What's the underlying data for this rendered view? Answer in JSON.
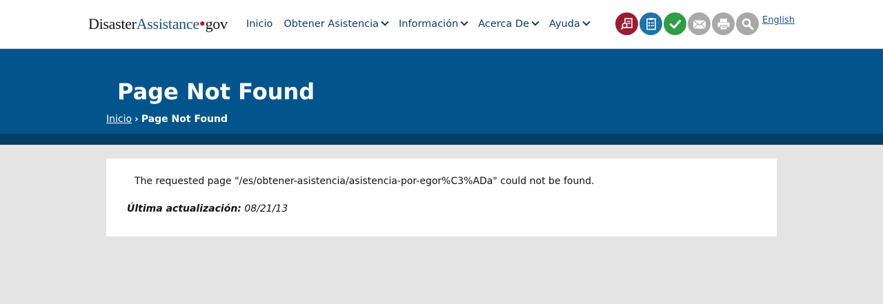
{
  "header": {
    "logo": {
      "part1": "Disaster",
      "part2": "Assistance",
      "dot": "•",
      "part3": "gov"
    },
    "nav": [
      {
        "label": "Inicio",
        "has_dropdown": false
      },
      {
        "label": "Obtener Asistencia",
        "has_dropdown": true
      },
      {
        "label": "Información",
        "has_dropdown": true
      },
      {
        "label": "Acerca De",
        "has_dropdown": true
      },
      {
        "label": "Ayuda",
        "has_dropdown": true
      }
    ],
    "tools": [
      {
        "icon": "document-search-icon",
        "color": "#9b1c2e"
      },
      {
        "icon": "checklist-icon",
        "color": "#1d73aa"
      },
      {
        "icon": "checkmark-icon",
        "color": "#2e9e44"
      },
      {
        "icon": "envelope-icon",
        "color": "#a9a9a9"
      },
      {
        "icon": "printer-icon",
        "color": "#a9a9a9"
      },
      {
        "icon": "search-icon",
        "color": "#a9a9a9"
      }
    ],
    "language_link": "English"
  },
  "banner": {
    "title": "Page Not Found",
    "breadcrumb": {
      "home": "Inicio",
      "separator": "›",
      "current": "Page Not Found"
    },
    "color": "#02558c",
    "strip_color": "#063f66"
  },
  "content": {
    "message": "The requested page \"/es/obtener-asistencia/asistencia-por-egor%C3%ADa\" could not be found.",
    "updated_label": "Última actualización:",
    "updated_value": "08/21/13"
  }
}
